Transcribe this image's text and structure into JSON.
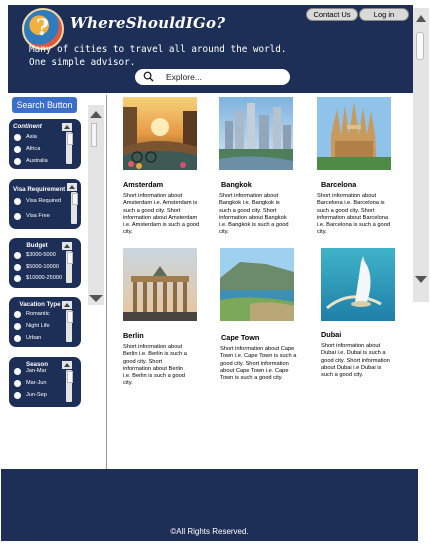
{
  "header": {
    "brand": "WhereShouldIGo?",
    "tagline": "Many of cities to travel all around the world.\nOne simple advisor.",
    "contact_label": "Contact Us",
    "login_label": "Log in",
    "search_placeholder": "Explore..."
  },
  "sidebar": {
    "search_button": "Search Button",
    "filters": [
      {
        "title": "Continent",
        "options": [
          "Asia",
          "Africa",
          "Australia"
        ]
      },
      {
        "title": "Visa Requirement",
        "options": [
          "Visa Required",
          "Visa Free"
        ]
      },
      {
        "title": "Budget",
        "options": [
          "$3000-5000",
          "$5000-10000",
          "$10000-25000"
        ]
      },
      {
        "title": "Vacation Type",
        "options": [
          "Romantic",
          "Night Life",
          "Urban"
        ]
      },
      {
        "title": "Season",
        "options": [
          "Jan-Mar",
          "Mar-Jun",
          "Jun-Sep"
        ]
      }
    ]
  },
  "cities": [
    {
      "name": "Amsterdam",
      "text": "Short information about Amsterdam i.e. Amsterdam is such a good city. Short information about Amsterdam i.e. Amsterdam is such a good city."
    },
    {
      "name": "Bangkok",
      "text": "Short information about Bangkok i.e. Bangkok is such a good city. Short information about Bangkok i.e. Bangkok is such a good city."
    },
    {
      "name": "Barcelona",
      "text": "Short information about Barcelona i.e. Barcelona is such a good city. Short information about Barcelona i.e. Barcelona is such a good city."
    },
    {
      "name": "Berlin",
      "text": "Short information about Berlin i.e. Berlin is such a good city. Short information about Berlin i.e. Berlin is such a good city."
    },
    {
      "name": "Cape Town",
      "text": "Short information about Cape Town i.e. Cape Town is such a good city. Short information about Cape Town i.e. Cape Town is such a good city."
    },
    {
      "name": "Dubai",
      "text": "Short information about Dubai i.e. Dubai is such a good city. Short information about Dubai i.e Dubai is such a good city."
    }
  ],
  "footer": {
    "copyright": "©All Rights Reserved."
  },
  "icons": {
    "logo": "globe-question-icon",
    "search": "search-icon",
    "scroll_up": "arrow-up-icon",
    "scroll_down": "arrow-down-icon"
  },
  "colors": {
    "navy": "#1e2f57",
    "button_blue": "#3b6fc9"
  }
}
